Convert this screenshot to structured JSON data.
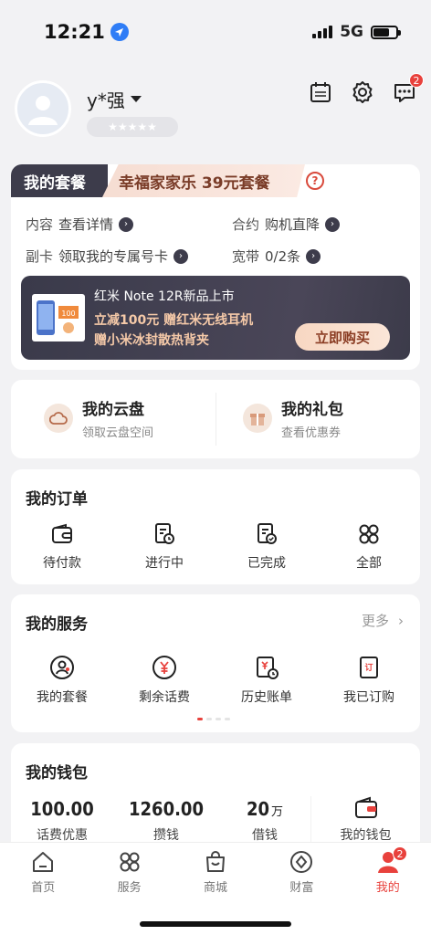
{
  "status": {
    "time": "12:21",
    "network": "5G"
  },
  "profile": {
    "username": "y*强",
    "stars": "★★★★★"
  },
  "plan": {
    "label": "我的套餐",
    "name": "幸福家家乐 39元套餐",
    "help": "?",
    "rows": [
      {
        "key": "内容",
        "value": "查看详情"
      },
      {
        "key": "合约",
        "value": "购机直降"
      },
      {
        "key": "副卡",
        "value": "领取我的专属号卡"
      },
      {
        "key": "宽带",
        "value": "0/2条"
      }
    ],
    "promo": {
      "title": "红米 Note 12R新品上市",
      "line2": "立减100元 赠红米无线耳机",
      "line3": "赠小米冰封散热背夹",
      "button": "立即购买"
    }
  },
  "quick": [
    {
      "title": "我的云盘",
      "sub": "领取云盘空间",
      "icon": "cloud-icon"
    },
    {
      "title": "我的礼包",
      "sub": "查看优惠券",
      "icon": "gift-icon"
    }
  ],
  "orders": {
    "title": "我的订单",
    "items": [
      {
        "label": "待付款",
        "icon": "wallet-icon"
      },
      {
        "label": "进行中",
        "icon": "clock-doc-icon"
      },
      {
        "label": "已完成",
        "icon": "check-doc-icon"
      },
      {
        "label": "全部",
        "icon": "grid-icon"
      }
    ]
  },
  "services": {
    "title": "我的服务",
    "more": "更多",
    "items": [
      {
        "label": "我的套餐",
        "icon": "package-icon"
      },
      {
        "label": "剩余话费",
        "icon": "yen-icon"
      },
      {
        "label": "历史账单",
        "icon": "bill-icon"
      },
      {
        "label": "我已订购",
        "icon": "ordered-icon"
      }
    ]
  },
  "wallet": {
    "title": "我的钱包",
    "items": [
      {
        "value": "100.00",
        "unit": "",
        "label": "话费优惠"
      },
      {
        "value": "1260.00",
        "unit": "",
        "label": "攒钱"
      },
      {
        "value": "20",
        "unit": "万",
        "label": "借钱"
      },
      {
        "value": "",
        "unit": "",
        "label": "我的钱包"
      }
    ]
  },
  "tabbar": {
    "tabs": [
      {
        "label": "首页",
        "icon": "home-icon"
      },
      {
        "label": "服务",
        "icon": "service-grid-icon"
      },
      {
        "label": "商城",
        "icon": "shop-bag-icon"
      },
      {
        "label": "财富",
        "icon": "wealth-icon"
      },
      {
        "label": "我的",
        "icon": "person-icon"
      }
    ],
    "active": "我的",
    "mine_badge": "2"
  },
  "message_badge": "2",
  "colors": {
    "accent": "#e8413c",
    "dark": "#3d3c4b",
    "gold": "#f5c9a8"
  }
}
